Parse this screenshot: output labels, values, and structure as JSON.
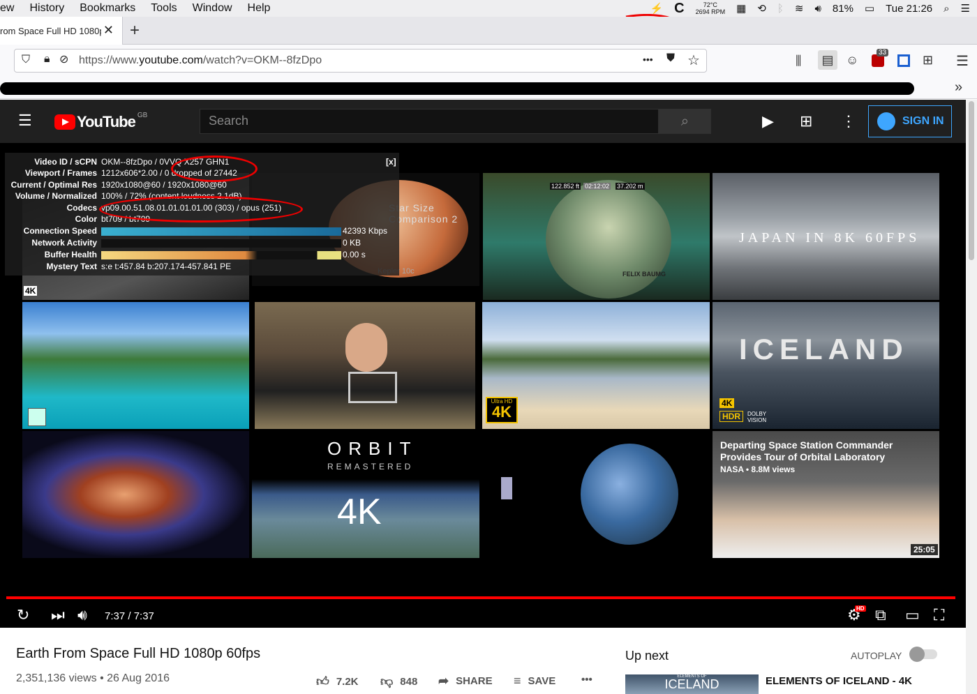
{
  "menubar": {
    "items": [
      "ew",
      "History",
      "Bookmarks",
      "Tools",
      "Window",
      "Help"
    ],
    "temp": "72°C",
    "rpm": "2694 RPM",
    "battery": "81%",
    "clock": "Tue 21:26"
  },
  "tab": {
    "title": "rom Space Full HD 1080p",
    "close": "✕",
    "new": "+"
  },
  "nav": {
    "url_prefix": "https://www.",
    "url_domain": "youtube.com",
    "url_rest": "/watch?v=OKM--8fzDpo",
    "more": "•••",
    "badge": "33"
  },
  "youtube": {
    "logo": "YouTube",
    "region": "GB",
    "search_placeholder": "Search",
    "sign_in": "SIGN IN"
  },
  "stats": {
    "close": "[x]",
    "rows": [
      {
        "label": "Video ID / sCPN",
        "value": "OKM--8fzDpo / 0VVQ X257 GHN1"
      },
      {
        "label": "Viewport / Frames",
        "value": "1212x606*2.00 / 0 dropped of 27442"
      },
      {
        "label": "Current / Optimal Res",
        "value": "1920x1080@60 / 1920x1080@60"
      },
      {
        "label": "Volume / Normalized",
        "value": "100% / 72% (content loudness 2.1dB)"
      },
      {
        "label": "Codecs",
        "value": "vp09.00.51.08.01.01.01.01.00 (303) / opus (251)"
      },
      {
        "label": "Color",
        "value": "bt709 / bt709"
      },
      {
        "label": "Connection Speed",
        "value": "42393 Kbps"
      },
      {
        "label": "Network Activity",
        "value": "0 KB"
      },
      {
        "label": "Buffer Health",
        "value": "0.00 s"
      },
      {
        "label": "Mystery Text",
        "value": "s:e t:457.84 b:207.174-457.841 PE"
      }
    ]
  },
  "tiles": {
    "t1_badge": "4K",
    "t2_title": "Star Size Comparison 2",
    "t2_sub": "Kepler 10c",
    "t3_hud": [
      "122.852 ft",
      "02:12:02",
      "37.202 m"
    ],
    "t3_name": "FELIX BAUMG",
    "t4_title": "JAPAN IN 8K 60FPS",
    "t7_badge_top": "Ultra HD",
    "t7_badge": "4K",
    "t8_title": "ICELAND",
    "t8_badge1": "4K",
    "t8_badge2": "HDR",
    "t8_dolby": "DOLBY VISION",
    "t10_title": "ORBIT",
    "t10_sub": "REMASTERED",
    "t10_badge": "4K",
    "t12_title": "Departing Space Station Commander Provides Tour of Orbital Laboratory",
    "t12_meta": "NASA • 8.8M views",
    "t12_duration": "25:05"
  },
  "player": {
    "time": "7:37 / 7:37",
    "hd": "HD"
  },
  "video": {
    "title": "Earth From Space Full HD 1080p 60fps",
    "views": "2,351,136 views • 26 Aug 2016",
    "likes": "7.2K",
    "dislikes": "848",
    "share": "SHARE",
    "save": "SAVE",
    "more": "•••"
  },
  "sidebar": {
    "up_next": "Up next",
    "autoplay": "AUTOPLAY",
    "next_thumb_small": "ELEMENTS OF",
    "next_thumb_big": "ICELAND",
    "next_title": "ELEMENTS OF ICELAND - 4K"
  }
}
